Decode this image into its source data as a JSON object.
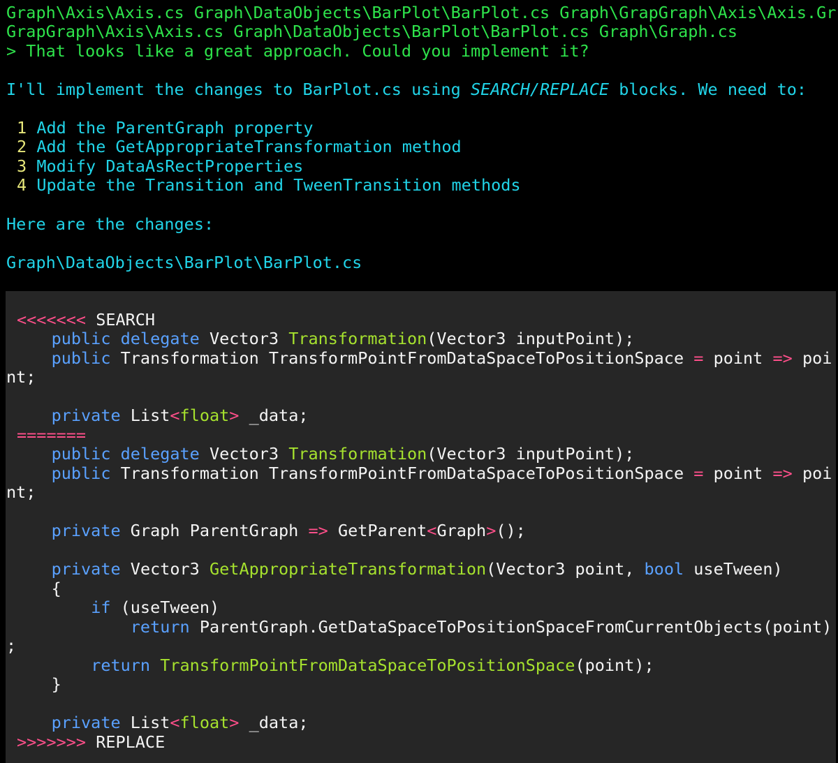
{
  "terminal": {
    "files_line_1": "Graph\\Axis\\Axis.cs Graph\\DataObjects\\BarPlot\\BarPlot.cs Graph\\GrapGraph\\Axis\\Axis.Gr",
    "files_line_2": "GrapGraph\\Axis\\Axis.cs Graph\\DataObjects\\BarPlot\\BarPlot.cs Graph\\Graph.cs",
    "prompt_symbol": "> ",
    "user_message": "That looks like a great approach. Could you implement it?",
    "intro_before": "I'll implement the changes to BarPlot.cs using ",
    "intro_italic": "SEARCH/REPLACE",
    "intro_after": " blocks. We need to:",
    "steps": [
      {
        "num": "1",
        "text": "Add the ParentGraph property"
      },
      {
        "num": "2",
        "text": "Add the GetAppropriateTransformation method"
      },
      {
        "num": "3",
        "text": "Modify DataAsRectProperties"
      },
      {
        "num": "4",
        "text": "Update the Transition and TweenTransition methods"
      }
    ],
    "here_text": "Here are the changes:",
    "file_path": "Graph\\DataObjects\\BarPlot\\BarPlot.cs"
  },
  "code": {
    "search_marker": "<<<<<<<",
    "search_label": " SEARCH",
    "divider": "=======",
    "replace_marker": ">>>>>>>",
    "replace_label": " REPLACE",
    "indent1": "    ",
    "indent2": "        ",
    "indent3": "            ",
    "kw_public": "public",
    "kw_private": "private",
    "kw_delegate": "delegate",
    "kw_bool": "bool",
    "kw_if": "if",
    "kw_return": "return",
    "type_vector3": "Vector3",
    "type_transformation": "Transformation",
    "type_graph": "Graph",
    "type_list": "List",
    "type_float": "float",
    "fn_transformation": "Transformation",
    "fn_get_appropriate": "GetAppropriateTransformation",
    "fn_transform_point": "TransformPointFromDataSpaceToPositionSpace",
    "param_input_point": "(Vector3 inputPoint);",
    "prop_transform_point": "TransformPointFromDataSpaceToPositionSpace",
    "op_eq": "=",
    "op_arrow": "=>",
    "op_lt": "<",
    "op_gt": ">",
    "word_point": "point",
    "word_poi": "poi",
    "wrap_nt": "nt;",
    "field_data": "_data;",
    "prop_parent_graph": "ParentGraph",
    "call_get_parent": "GetParent",
    "call_end": "();",
    "method_params_a": "(Vector3 point, ",
    "method_params_b": "useTween)",
    "brace_open": "{",
    "brace_close": "}",
    "if_cond": "(useTween)",
    "return_expr": "ParentGraph.GetDataSpaceToPositionSpaceFromCurrentObjects(point)",
    "wrap_semicolon": ";",
    "return_args": "(point);"
  }
}
